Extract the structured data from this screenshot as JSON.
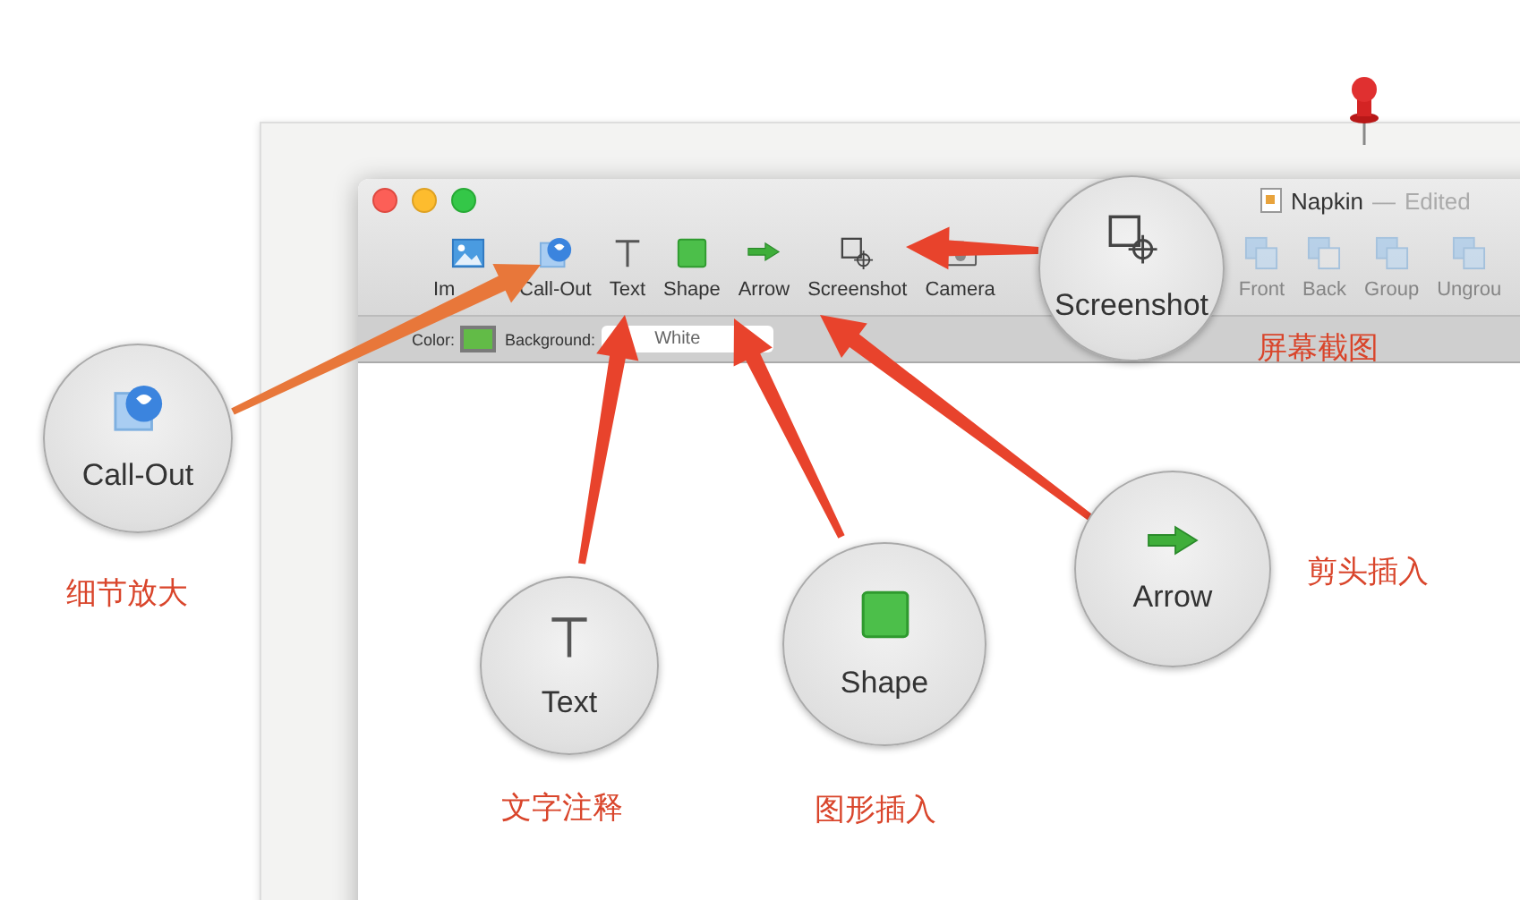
{
  "window": {
    "title": "Napkin",
    "separator": "—",
    "status": "Edited"
  },
  "toolbar": [
    {
      "kind": "image",
      "label": "Im",
      "disabled": false
    },
    {
      "kind": "callout",
      "label": "Call-Out",
      "disabled": false
    },
    {
      "kind": "text",
      "label": "Text",
      "disabled": false
    },
    {
      "kind": "shape",
      "label": "Shape",
      "disabled": false
    },
    {
      "kind": "arrow",
      "label": "Arrow",
      "disabled": false
    },
    {
      "kind": "screenshot",
      "label": "Screenshot",
      "disabled": false
    },
    {
      "kind": "camera",
      "label": "Camera",
      "disabled": false
    },
    {
      "kind": "front",
      "label": "Front",
      "disabled": true
    },
    {
      "kind": "back",
      "label": "Back",
      "disabled": true
    },
    {
      "kind": "group",
      "label": "Group",
      "disabled": true
    },
    {
      "kind": "ungroup",
      "label": "Ungrou",
      "disabled": true
    }
  ],
  "format_bar": {
    "color_label": "Color:",
    "background_label": "Background:",
    "background_value": "White"
  },
  "callouts": [
    {
      "kind": "screenshot",
      "label": "Screenshot",
      "caption": "屏幕截图"
    },
    {
      "kind": "callout",
      "label": "Call-Out",
      "caption": "细节放大"
    },
    {
      "kind": "text",
      "label": "Text",
      "caption": "文字注释"
    },
    {
      "kind": "shape",
      "label": "Shape",
      "caption": "图形插入"
    },
    {
      "kind": "arrow",
      "label": "Arrow",
      "caption": "剪头插入"
    }
  ]
}
